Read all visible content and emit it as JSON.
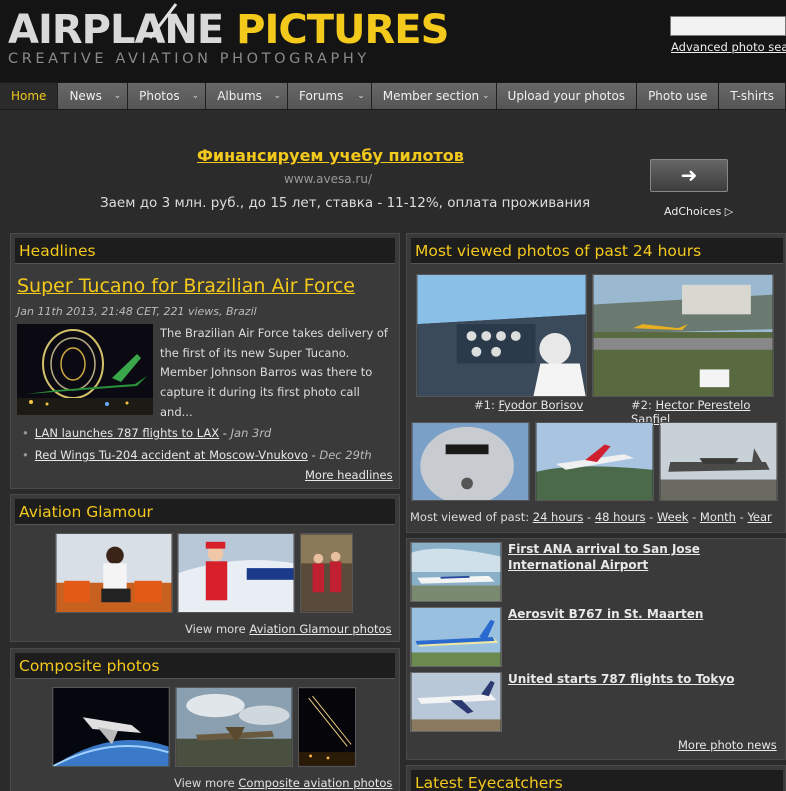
{
  "header": {
    "logo_word1": "AIRPLANE",
    "logo_word2": "PICTURES",
    "logo_tagline": "CREATIVE AVIATION PHOTOGRAPHY",
    "advanced_search": "Advanced photo sea"
  },
  "nav": {
    "items": [
      {
        "label": "Home",
        "active": true,
        "dropdown": false
      },
      {
        "label": "News",
        "dropdown": true
      },
      {
        "label": "Photos",
        "dropdown": true
      },
      {
        "label": "Albums",
        "dropdown": true
      },
      {
        "label": "Forums",
        "dropdown": true
      },
      {
        "label": "Member section",
        "dropdown": true
      },
      {
        "label": "Upload your photos",
        "dropdown": false
      },
      {
        "label": "Photo use",
        "dropdown": false
      },
      {
        "label": "T-shirts",
        "dropdown": false
      }
    ],
    "dropdown_glyph": "⌄"
  },
  "ad": {
    "title": "Финансируем учебу пилотов",
    "url": "www.avesa.ru/",
    "text": "Заем до 3 млн. руб., до 15 лет, ставка - 11-12%, оплата проживания",
    "button_glyph": "➜",
    "adchoices": "AdChoices ▷"
  },
  "headlines": {
    "heading": "Headlines",
    "title": "Super Tucano for Brazilian Air Force",
    "meta": "Jan 11th 2013, 21:48 CET, 221 views, Brazil",
    "summary": "The Brazilian Air Force takes delivery of the first of its new Super Tucano. Member Johnson Barros was there to capture it during its first photo call and...",
    "items": [
      {
        "title": "LAN launches 787 flights to LAX",
        "date": "Jan 3rd"
      },
      {
        "title": "Red Wings Tu-204 accident at Moscow-Vnukovo",
        "date": "Dec 29th"
      }
    ],
    "more": "More headlines"
  },
  "glamour": {
    "heading": "Aviation Glamour",
    "view_more_prefix": "View more",
    "view_more_link": "Aviation Glamour photos"
  },
  "composite": {
    "heading": "Composite photos",
    "view_more_prefix": "View more",
    "view_more_link": "Composite aviation photos"
  },
  "most_viewed": {
    "heading": "Most viewed photos of past 24 hours",
    "photo1_rank": "#1:",
    "photo1_author": "Fyodor Borisov",
    "photo2_rank": "#2:",
    "photo2_author": "Hector Perestelo Sanfiel",
    "past_label": "Most viewed of past:",
    "periods": [
      "24 hours",
      "48 hours",
      "Week",
      "Month",
      "Year"
    ]
  },
  "news": {
    "items": [
      {
        "title": "First ANA arrival to San Jose International Airport"
      },
      {
        "title": "Aerosvit B767 in St. Maarten"
      },
      {
        "title": "United starts 787 flights to Tokyo"
      }
    ],
    "more": "More photo news"
  },
  "eyecatchers": {
    "heading": "Latest Eyecatchers"
  }
}
